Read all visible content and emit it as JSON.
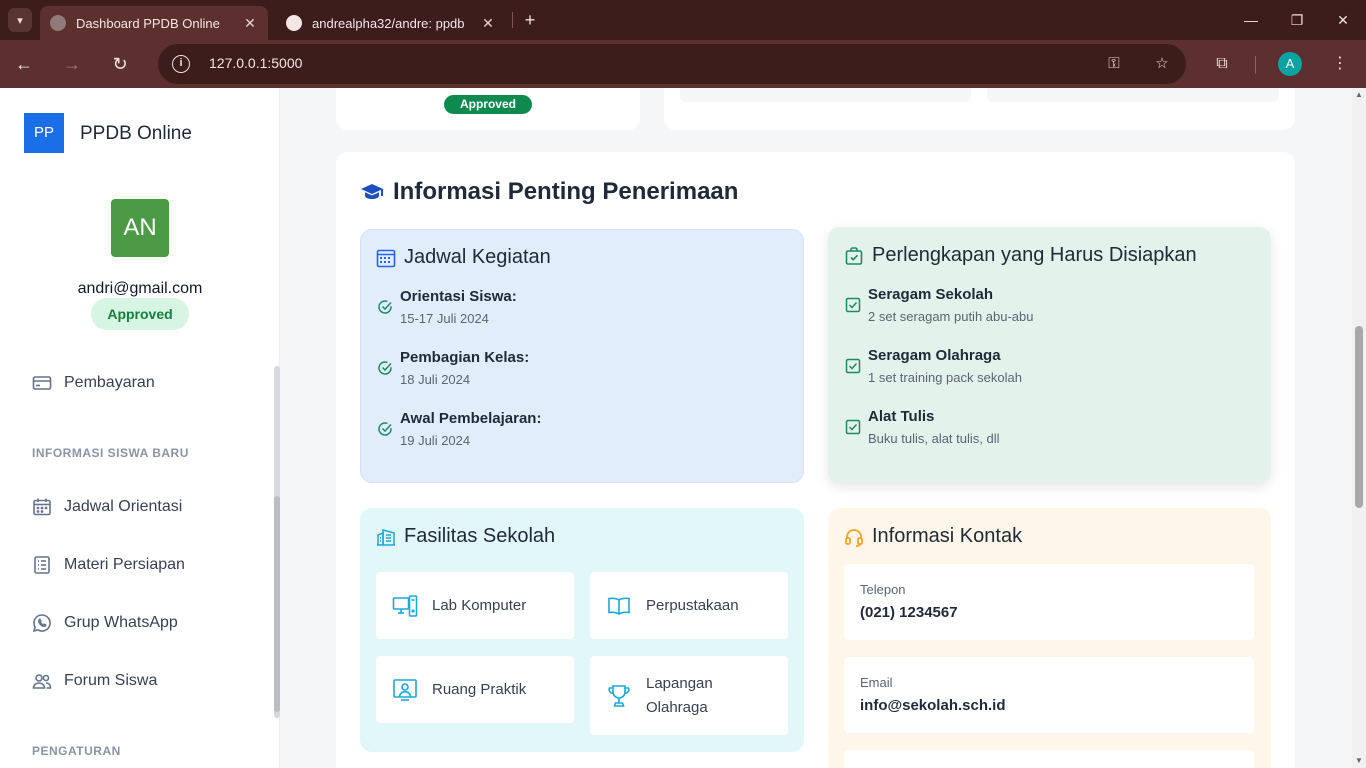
{
  "browser": {
    "tabs": [
      {
        "title": "Dashboard PPDB Online",
        "active": true
      },
      {
        "title": "andrealpha32/andre: ppdb",
        "active": false
      }
    ],
    "url": "127.0.0.1:5000",
    "profile_initial": "A"
  },
  "sidebar": {
    "logo": "PP",
    "brand": "PPDB Online",
    "avatar_initials": "AN",
    "email": "andri@gmail.com",
    "status": "Approved",
    "items": [
      {
        "label": "Pembayaran",
        "icon": "credit-card-icon"
      },
      {
        "label": "Jadwal Orientasi",
        "icon": "calendar-icon"
      },
      {
        "label": "Materi Persiapan",
        "icon": "document-list-icon"
      },
      {
        "label": "Grup WhatsApp",
        "icon": "whatsapp-icon"
      },
      {
        "label": "Forum Siswa",
        "icon": "users-icon"
      }
    ],
    "sections": {
      "info": "INFORMASI SISWA BARU",
      "settings": "PENGATURAN"
    }
  },
  "top_card": {
    "status": "Approved"
  },
  "info": {
    "title": "Informasi Penting Penerimaan",
    "schedule": {
      "title": "Jadwal Kegiatan",
      "items": [
        {
          "label": "Orientasi Siswa:",
          "value": "15-17 Juli 2024"
        },
        {
          "label": "Pembagian Kelas:",
          "value": "18 Juli 2024"
        },
        {
          "label": "Awal Pembelajaran:",
          "value": "19 Juli 2024"
        }
      ]
    },
    "equipment": {
      "title": "Perlengkapan yang Harus Disiapkan",
      "items": [
        {
          "label": "Seragam Sekolah",
          "value": "2 set seragam putih abu-abu"
        },
        {
          "label": "Seragam Olahraga",
          "value": "1 set training pack sekolah"
        },
        {
          "label": "Alat Tulis",
          "value": "Buku tulis, alat tulis, dll"
        }
      ]
    },
    "facilities": {
      "title": "Fasilitas Sekolah",
      "items": [
        {
          "label": "Lab Komputer",
          "icon": "computer-icon"
        },
        {
          "label": "Perpustakaan",
          "icon": "book-icon"
        },
        {
          "label": "Ruang Praktik",
          "icon": "presentation-icon"
        },
        {
          "label": "Lapangan Olahraga",
          "icon": "trophy-icon"
        }
      ]
    },
    "contact": {
      "title": "Informasi Kontak",
      "items": [
        {
          "label": "Telepon",
          "value": "(021) 1234567"
        },
        {
          "label": "Email",
          "value": "info@sekolah.sch.id"
        }
      ]
    }
  },
  "colors": {
    "brand_blue": "#1a6fe8",
    "approved_green": "#0f8a4f",
    "schedule_bg": "#e2edfb",
    "equipment_bg": "#e4f2ec",
    "facilities_bg": "#e1f7fa",
    "contact_bg": "#fef6e8"
  }
}
